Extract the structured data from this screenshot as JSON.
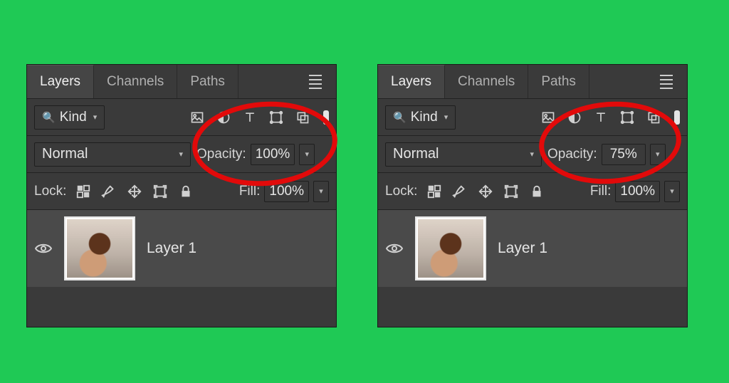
{
  "panels": [
    {
      "tabs": {
        "layers": "Layers",
        "channels": "Channels",
        "paths": "Paths",
        "active": "layers"
      },
      "filter": {
        "kind_label": "Kind"
      },
      "blend": {
        "mode": "Normal",
        "opacity_label": "Opacity:",
        "opacity_value": "100%"
      },
      "lock": {
        "label": "Lock:",
        "fill_label": "Fill:",
        "fill_value": "100%"
      },
      "layers": [
        {
          "name": "Layer 1",
          "visible": true
        }
      ]
    },
    {
      "tabs": {
        "layers": "Layers",
        "channels": "Channels",
        "paths": "Paths",
        "active": "layers"
      },
      "filter": {
        "kind_label": "Kind"
      },
      "blend": {
        "mode": "Normal",
        "opacity_label": "Opacity:",
        "opacity_value": "75%"
      },
      "lock": {
        "label": "Lock:",
        "fill_label": "Fill:",
        "fill_value": "100%"
      },
      "layers": [
        {
          "name": "Layer 1",
          "visible": true
        }
      ]
    }
  ],
  "annotation": {
    "type": "ellipse",
    "color": "#e20a0a",
    "target": "opacity-control"
  }
}
